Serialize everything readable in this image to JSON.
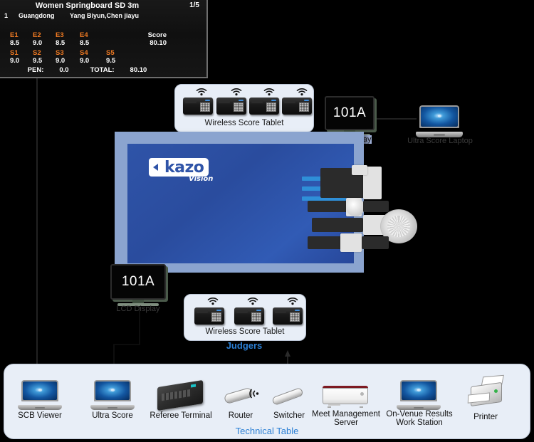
{
  "scoreboard": {
    "title": "Women Springboard SD 3m",
    "heat": "1/5",
    "rank": "1",
    "team": "Guangdong",
    "athletes": "Yang Biyun,Chen jiayu",
    "execution_labels": [
      "E1",
      "E2",
      "E3",
      "E4"
    ],
    "execution_values": [
      "8.5",
      "9.0",
      "8.5",
      "8.5"
    ],
    "sync_labels": [
      "S1",
      "S2",
      "S3",
      "S4",
      "S5"
    ],
    "sync_values": [
      "9.0",
      "9.5",
      "9.0",
      "9.0",
      "9.5"
    ],
    "score_label": "Score",
    "score_value": "80.10",
    "pen_label": "PEN:",
    "pen_value": "0.0",
    "total_label": "TOTAL:",
    "total_value": "80.10",
    "accent_color": "#f07a22"
  },
  "tablets_top": {
    "label": "Wireless Score Tablet",
    "count": 4,
    "icon": "wifi-icon"
  },
  "tablets_bottom": {
    "label": "Wireless Score Tablet",
    "count": 3,
    "icon": "wifi-icon",
    "group_label": "Judgers",
    "group_label_color": "#2b7fd4"
  },
  "lcd_top": {
    "number": "101A",
    "caption": "LCD Display"
  },
  "lcd_bottom": {
    "number": "101A",
    "caption": "LCD Display"
  },
  "laptop_top": {
    "caption": "Ultra Score Laptop"
  },
  "big_display": {
    "logo_text": "kazo",
    "logo_sub": "Vision",
    "logo_color": "#2f54a8"
  },
  "tech_table": {
    "label": "Technical Table",
    "label_color": "#2b7fd4",
    "devices": [
      {
        "name": "scb-viewer",
        "caption": "SCB Viewer",
        "type": "laptop"
      },
      {
        "name": "ultra-score",
        "caption": "Ultra Score",
        "type": "laptop"
      },
      {
        "name": "referee-terminal",
        "caption": "Referee Terminal",
        "type": "terminal"
      },
      {
        "name": "router",
        "caption": "Router",
        "type": "router"
      },
      {
        "name": "switcher",
        "caption": "Switcher",
        "type": "switcher"
      },
      {
        "name": "meet-management-server",
        "caption": "Meet Management\nServer",
        "type": "server"
      },
      {
        "name": "on-venue-results",
        "caption": "On-Venue Results\nWork Station",
        "type": "laptop"
      },
      {
        "name": "printer",
        "caption": "Printer",
        "type": "printer"
      }
    ]
  },
  "colors": {
    "background": "#000000",
    "panel": "#e8eef7",
    "accent_blue": "#2b7fd4",
    "display_blue": "#2f54a8",
    "display_frame": "#8ba4cf",
    "orange": "#f07a22"
  }
}
